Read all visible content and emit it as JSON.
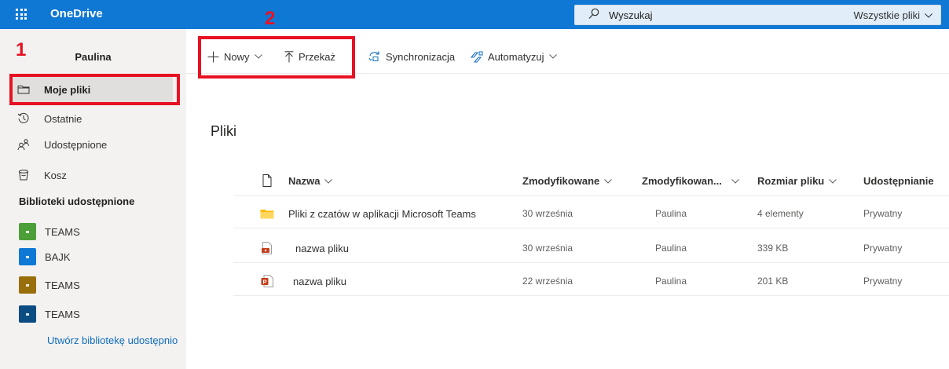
{
  "topbar": {
    "app_name": "OneDrive",
    "search_placeholder": "Wyszukaj",
    "search_scope": "Wszystkie pliki"
  },
  "sidebar": {
    "user": "Paulina",
    "nav": [
      {
        "label": "Moje pliki",
        "icon": "folder-icon",
        "active": true
      },
      {
        "label": "Ostatnie",
        "icon": "clock-icon"
      },
      {
        "label": "Udostępnione",
        "icon": "people-icon"
      },
      {
        "label": "Kosz",
        "icon": "trash-icon"
      }
    ],
    "libraries_header": "Biblioteki udostępnione",
    "libraries": [
      {
        "label": "TEAMS",
        "color": "#4c9f38"
      },
      {
        "label": "BAJK",
        "color": "#0f78d4"
      },
      {
        "label": "TEAMS",
        "color": "#986f0b"
      },
      {
        "label": "TEAMS",
        "color": "#0b4c82"
      }
    ],
    "create_library": "Utwórz bibliotekę udostępnio"
  },
  "commandbar": {
    "new": "Nowy",
    "upload": "Przekaż",
    "sync": "Synchronizacja",
    "automate": "Automatyzuj"
  },
  "annotations": {
    "one": "1",
    "two": "2",
    "color": "#e81123"
  },
  "main": {
    "title": "Pliki",
    "columns": {
      "name": "Nazwa",
      "modified": "Zmodyfikowane",
      "modified_by": "Zmodyfikowan...",
      "size": "Rozmiar pliku",
      "sharing": "Udostępnianie"
    },
    "rows": [
      {
        "icon": "folder-icon",
        "name": "Pliki z czatów w aplikacji Microsoft Teams",
        "modified": "30 września",
        "modified_by": "Paulina",
        "size": "4 elementy",
        "sharing": "Prywatny"
      },
      {
        "icon": "video-file-icon",
        "name": "nazwa pliku",
        "modified": "30 września",
        "modified_by": "Paulina",
        "size": "339 KB",
        "sharing": "Prywatny"
      },
      {
        "icon": "powerpoint-file-icon",
        "name": "nazwa pliku",
        "modified": "22 września",
        "modified_by": "Paulina",
        "size": "201 KB",
        "sharing": "Prywatny"
      }
    ]
  }
}
